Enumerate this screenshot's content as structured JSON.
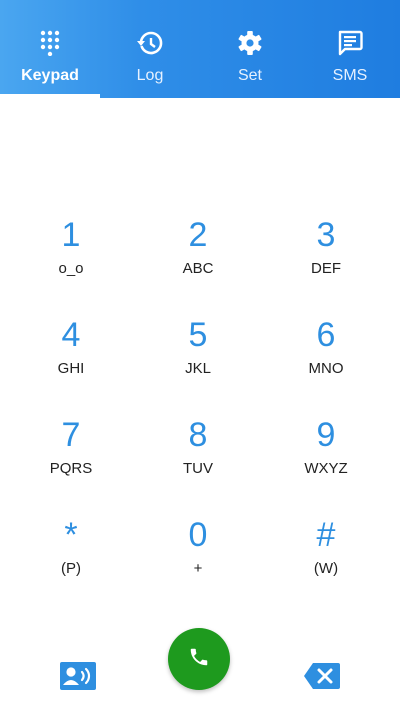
{
  "tabs": [
    {
      "label": "Keypad",
      "icon": "dialpad-icon",
      "active": true
    },
    {
      "label": "Log",
      "icon": "history-icon",
      "active": false
    },
    {
      "label": "Set",
      "icon": "gear-icon",
      "active": false
    },
    {
      "label": "SMS",
      "icon": "message-icon",
      "active": false
    }
  ],
  "keys": [
    {
      "digit": "1",
      "letters": "o_o"
    },
    {
      "digit": "2",
      "letters": "ABC"
    },
    {
      "digit": "3",
      "letters": "DEF"
    },
    {
      "digit": "4",
      "letters": "GHI"
    },
    {
      "digit": "5",
      "letters": "JKL"
    },
    {
      "digit": "6",
      "letters": "MNO"
    },
    {
      "digit": "7",
      "letters": "PQRS"
    },
    {
      "digit": "8",
      "letters": "TUV"
    },
    {
      "digit": "9",
      "letters": "WXYZ"
    },
    {
      "digit": "*",
      "letters": "(P)"
    },
    {
      "digit": "0",
      "letters": "+"
    },
    {
      "digit": "#",
      "letters": "(W)"
    }
  ],
  "bottom": {
    "contacts_icon": "contacts-icon",
    "call_icon": "phone-icon",
    "backspace_icon": "backspace-icon"
  },
  "colors": {
    "accent": "#2e8fe0",
    "call": "#1e9a1e",
    "topbar": "#2f8ee8"
  }
}
